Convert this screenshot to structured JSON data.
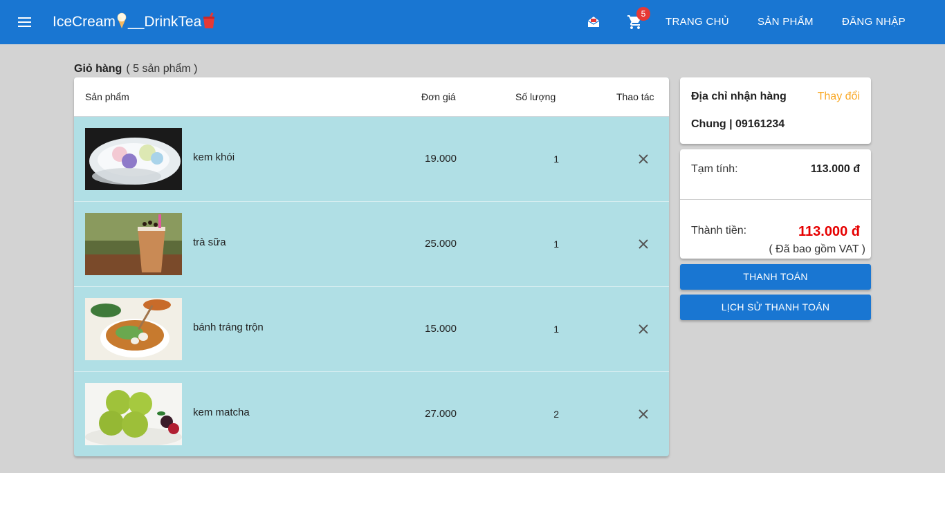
{
  "appbar": {
    "brand": "IceCream",
    "brand_sep": "__DrinkTea",
    "cart_count": "5",
    "nav": [
      "TRANG CHỦ",
      "SẢN PHẨM",
      "ĐĂNG NHẬP"
    ]
  },
  "cart": {
    "title": "Giỏ hàng",
    "count_text": "( 5 sản phẩm )",
    "columns": [
      "Sản phẩm",
      "Đơn giá",
      "Số lượng",
      "Thao tác"
    ],
    "items": [
      {
        "name": "kem khói",
        "price": "19.000",
        "qty": "1",
        "image": "smoke-ice-cream"
      },
      {
        "name": "trà sữa",
        "price": "25.000",
        "qty": "1",
        "image": "milk-tea"
      },
      {
        "name": "bánh tráng trộn",
        "price": "15.000",
        "qty": "1",
        "image": "rice-paper-salad"
      },
      {
        "name": "kem matcha",
        "price": "27.000",
        "qty": "2",
        "image": "matcha-ice-cream"
      }
    ]
  },
  "address": {
    "title": "Địa chỉ nhận hàng",
    "change_label": "Thay đổi",
    "value": "Chung | 09161234"
  },
  "summary": {
    "subtotal_label": "Tạm tính:",
    "subtotal_value": "113.000 đ",
    "total_label": "Thành tiền:",
    "total_value": "113.000 đ",
    "vat_note": "( Đã bao gồm VAT )"
  },
  "actions": {
    "checkout": "THANH TOÁN",
    "history": "LỊCH SỬ THANH TOÁN"
  },
  "colors": {
    "primary": "#1976d2",
    "background": "#d3d3d3",
    "cart_rows": "#b0dfe5",
    "accent": "#f9a825",
    "total": "#e60000",
    "badge": "#e53935"
  }
}
